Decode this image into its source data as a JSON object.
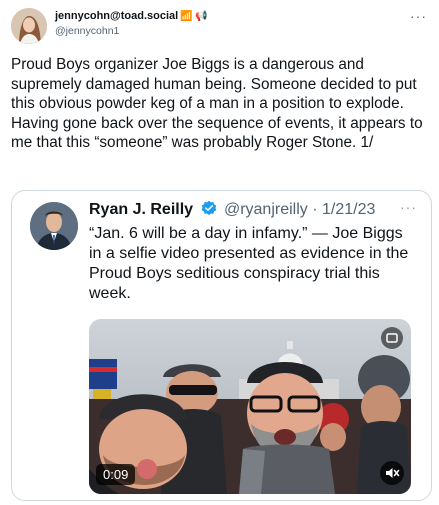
{
  "post": {
    "author_display": "jennycohn@toad.social",
    "author_emoji": "📶 📢",
    "author_handle": "@jennycohn1",
    "more_icon": "ellipsis-icon",
    "text": "Proud Boys organizer Joe Biggs is a dangerous and supremely damaged human being. Someone decided to put this obvious powder keg of a man in a position to explode. Having gone back over the sequence of events, it appears to me that this “someone” was probably Roger Stone. 1/"
  },
  "quote": {
    "name": "Ryan J. Reilly",
    "handle_date": "@ryanjreilly · 1/21/23",
    "verified_icon": "verified-badge-icon",
    "verified_color": "#1d9bf0",
    "text": "“Jan. 6 will be a day in infamy.” — Joe Biggs in a selfie video presented as evidence in the Proud Boys seditious conspiracy trial this week.",
    "video_duration": "0:09",
    "mute_icon": "speaker-muted-icon"
  }
}
